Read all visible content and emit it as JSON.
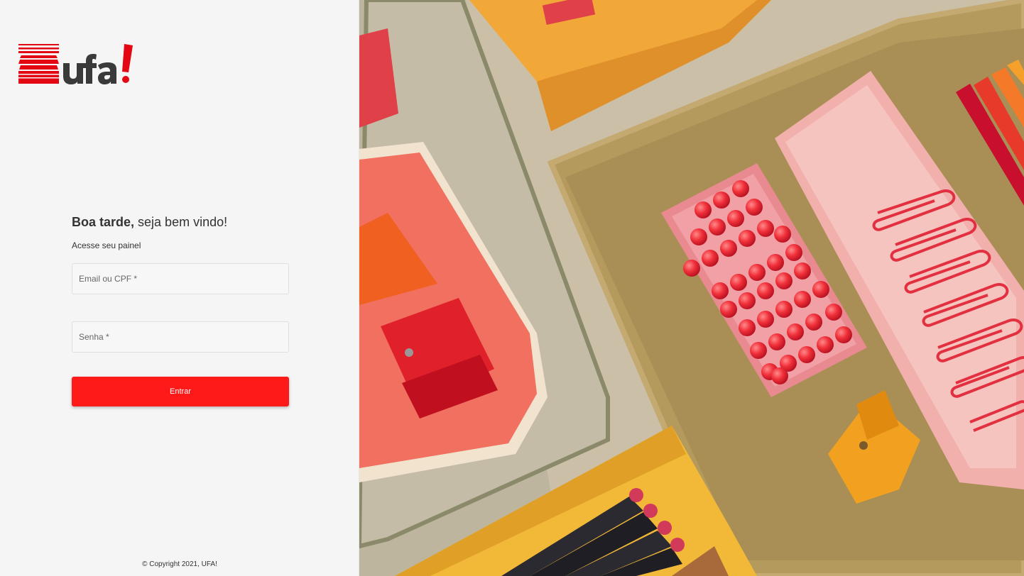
{
  "brand": {
    "name": "ufa!",
    "accent_color": "#e30613",
    "text_color": "#3a3a3a"
  },
  "login": {
    "greeting_bold": "Boa tarde,",
    "greeting_rest": " seja bem vindo!",
    "subtitle": "Acesse seu painel",
    "email_placeholder": "Email ou CPF *",
    "password_placeholder": "Senha *",
    "submit_label": "Entrar",
    "button_color": "#ff1a1a"
  },
  "footer": {
    "copyright": "© Copyright 2021, UFA!"
  },
  "hero_image": {
    "subject": "office-supplies-photo"
  }
}
